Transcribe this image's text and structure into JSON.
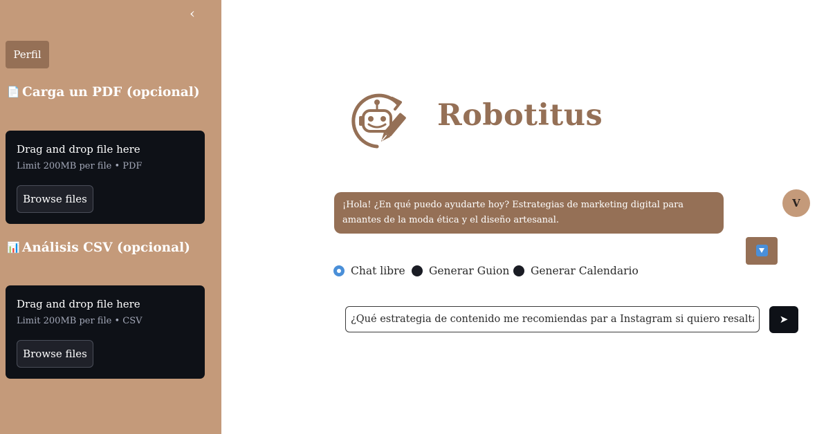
{
  "sidebar": {
    "collapse_icon": "‹",
    "profile_label": "Perfil",
    "sections": [
      {
        "icon": "📄",
        "title": "Carga un PDF (opcional)",
        "drag_text": "Drag and drop file here",
        "limit_text": "Limit 200MB per file • PDF",
        "browse_label": "Browse files"
      },
      {
        "icon": "📊",
        "title": "Análisis CSV (opcional)",
        "drag_text": "Drag and drop file here",
        "limit_text": "Limit 200MB per file • CSV",
        "browse_label": "Browse files"
      }
    ]
  },
  "main": {
    "app_title": "Robotitus",
    "chat": {
      "assistant_message": "¡Hola! ¿En qué puedo ayudarte hoy? Estrategias de marketing digital para amantes de la moda ética y el diseño artesanal.",
      "user_avatar": "V"
    },
    "modes": {
      "selected": "Chat libre",
      "options": [
        "Chat libre",
        "Generar Guion",
        "Generar Calendario"
      ]
    },
    "input": {
      "value": "¿Qué estrategia de contenido me recomiendas par a Instagram si quiero resaltar el"
    },
    "send_icon": "➤"
  },
  "colors": {
    "sidebar_bg": "#c49a7a",
    "accent_brown": "#957056",
    "dark_panel": "#0e1117",
    "radio_selected": "#4a8fd8"
  }
}
